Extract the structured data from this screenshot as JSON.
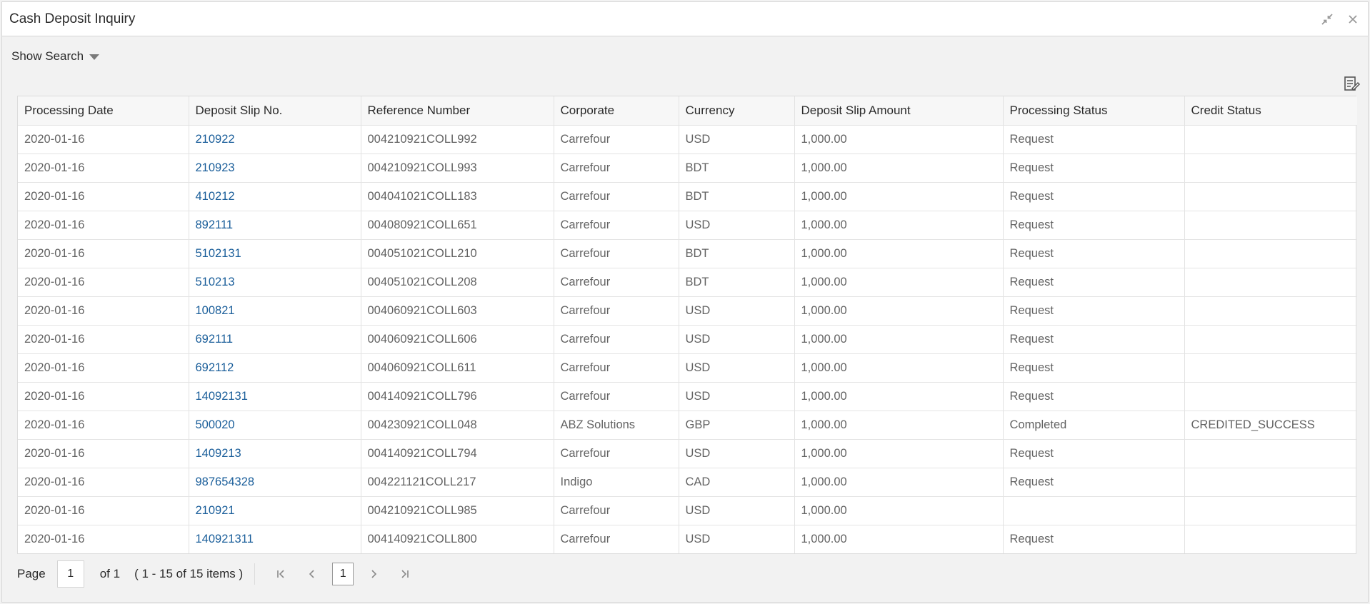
{
  "window": {
    "title": "Cash Deposit Inquiry",
    "icons": [
      "minimize-icon",
      "close-icon"
    ]
  },
  "search": {
    "toggle_label": "Show Search",
    "icon": "caret-down-icon"
  },
  "toolbar": {
    "export_icon": "export-icon"
  },
  "table": {
    "columns": [
      "Processing Date",
      "Deposit Slip No.",
      "Reference Number",
      "Corporate",
      "Currency",
      "Deposit Slip Amount",
      "Processing Status",
      "Credit Status"
    ],
    "rows": [
      [
        "2020-01-16",
        "210922",
        "004210921COLL992",
        "Carrefour",
        "USD",
        "1,000.00",
        "Request",
        ""
      ],
      [
        "2020-01-16",
        "210923",
        "004210921COLL993",
        "Carrefour",
        "BDT",
        "1,000.00",
        "Request",
        ""
      ],
      [
        "2020-01-16",
        "410212",
        "004041021COLL183",
        "Carrefour",
        "BDT",
        "1,000.00",
        "Request",
        ""
      ],
      [
        "2020-01-16",
        "892111",
        "004080921COLL651",
        "Carrefour",
        "USD",
        "1,000.00",
        "Request",
        ""
      ],
      [
        "2020-01-16",
        "5102131",
        "004051021COLL210",
        "Carrefour",
        "BDT",
        "1,000.00",
        "Request",
        ""
      ],
      [
        "2020-01-16",
        "510213",
        "004051021COLL208",
        "Carrefour",
        "BDT",
        "1,000.00",
        "Request",
        ""
      ],
      [
        "2020-01-16",
        "100821",
        "004060921COLL603",
        "Carrefour",
        "USD",
        "1,000.00",
        "Request",
        ""
      ],
      [
        "2020-01-16",
        "692111",
        "004060921COLL606",
        "Carrefour",
        "USD",
        "1,000.00",
        "Request",
        ""
      ],
      [
        "2020-01-16",
        "692112",
        "004060921COLL611",
        "Carrefour",
        "USD",
        "1,000.00",
        "Request",
        ""
      ],
      [
        "2020-01-16",
        "14092131",
        "004140921COLL796",
        "Carrefour",
        "USD",
        "1,000.00",
        "Request",
        ""
      ],
      [
        "2020-01-16",
        "500020",
        "004230921COLL048",
        "ABZ Solutions",
        "GBP",
        "1,000.00",
        "Completed",
        "CREDITED_SUCCESS"
      ],
      [
        "2020-01-16",
        "1409213",
        "004140921COLL794",
        "Carrefour",
        "USD",
        "1,000.00",
        "Request",
        ""
      ],
      [
        "2020-01-16",
        "987654328",
        "004221121COLL217",
        "Indigo",
        "CAD",
        "1,000.00",
        "Request",
        ""
      ],
      [
        "2020-01-16",
        "210921",
        "004210921COLL985",
        "Carrefour",
        "USD",
        "1,000.00",
        "",
        ""
      ],
      [
        "2020-01-16",
        "140921311",
        "004140921COLL800",
        "Carrefour",
        "USD",
        "1,000.00",
        "Request",
        ""
      ]
    ]
  },
  "pagination": {
    "page_label": "Page",
    "page_value": "1",
    "of_label": "of 1",
    "items_label": "( 1 - 15 of 15 items )",
    "current_page": "1",
    "icons": [
      "first-page-icon",
      "prev-page-icon",
      "next-page-icon",
      "last-page-icon"
    ]
  },
  "colors": {
    "link": "#1a5e9a",
    "text": "#636363",
    "header_bg": "#f7f7f7",
    "page_bg": "#f2f2f2"
  }
}
